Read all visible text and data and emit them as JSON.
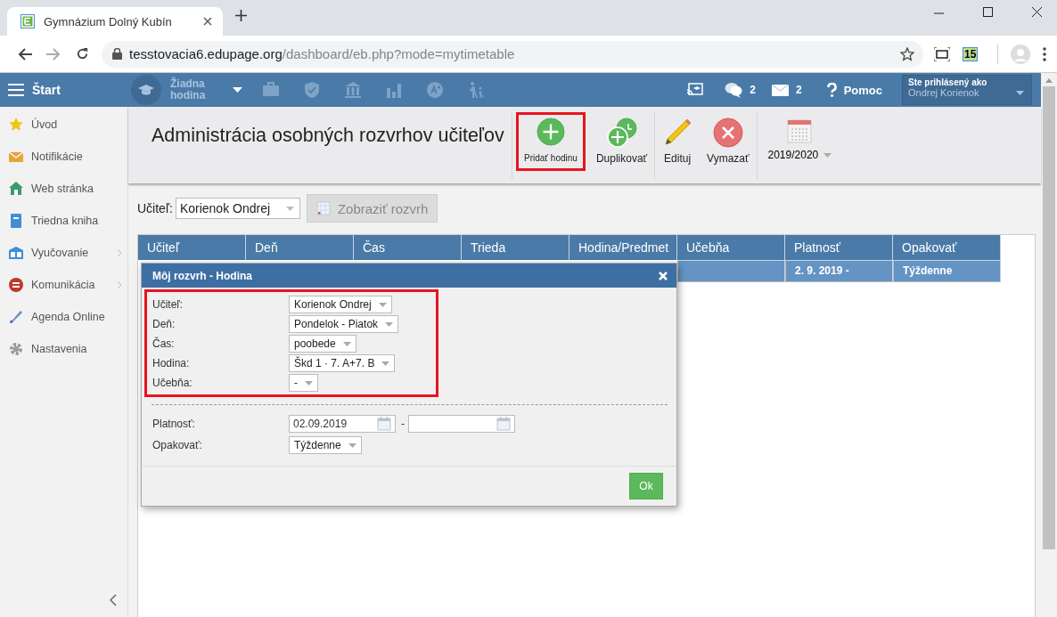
{
  "browser": {
    "tab_title": "Gymnázium Dolný Kubín",
    "url_host": "tesstovacia6.edupage.org",
    "url_path": "/dashboard/eb.php?mode=mytimetable",
    "extension_badge": "15"
  },
  "header": {
    "menu_label": "Štart",
    "lesson_selector": "Žiadna hodina",
    "chat_count": "2",
    "mail_count": "2",
    "help_label": "Pomoc",
    "user_caption": "Ste prihlásený ako",
    "user_name": "Ondrej Korienok"
  },
  "sidebar": {
    "items": [
      {
        "label": "Úvod",
        "has_submenu": false
      },
      {
        "label": "Notifikácie",
        "has_submenu": false
      },
      {
        "label": "Web stránka",
        "has_submenu": false
      },
      {
        "label": "Triedna kniha",
        "has_submenu": false
      },
      {
        "label": "Vyučovanie",
        "has_submenu": true
      },
      {
        "label": "Komunikácia",
        "has_submenu": true
      },
      {
        "label": "Agenda Online",
        "has_submenu": false
      },
      {
        "label": "Nastavenia",
        "has_submenu": false
      }
    ]
  },
  "page_title": "Administrácia osobných rozvrhov učiteľov",
  "toolbar": {
    "buttons": [
      {
        "label": "Pridať hodinu",
        "highlighted": true
      },
      {
        "label": "Duplikovať",
        "highlighted": false
      },
      {
        "label": "Edituj",
        "highlighted": false
      },
      {
        "label": "Vymazať",
        "highlighted": false
      }
    ],
    "year_selector": "2019/2020"
  },
  "filter": {
    "label": "Učiteľ:",
    "teacher": "Korienok Ondrej",
    "show_button": {
      "label": "Zobraziť rozvrh",
      "disabled": true
    }
  },
  "table": {
    "columns": [
      "Učiteľ",
      "Deň",
      "Čas",
      "Trieda",
      "Hodina/Predmet",
      "Učebňa",
      "Platnosť",
      "Opakovať"
    ],
    "rows": [
      {
        "selected": true,
        "validity": "2. 9. 2019 -",
        "repeat": "Týždenne"
      }
    ]
  },
  "dialog": {
    "title": "Môj rozvrh - Hodina",
    "highlighted_fields": [
      {
        "label": "Učiteľ:",
        "value": "Korienok Ondrej"
      },
      {
        "label": "Deň:",
        "value": "Pondelok - Piatok"
      },
      {
        "label": "Čas:",
        "value": "poobede"
      },
      {
        "label": "Hodina:",
        "value": "Škd 1 · 7. A+7. B"
      },
      {
        "label": "Učebňa:",
        "value": "-"
      }
    ],
    "validity": {
      "label": "Platnosť:",
      "from": "02.09.2019",
      "separator": "-"
    },
    "repeat": {
      "label": "Opakovať:",
      "value": "Týždenne"
    },
    "ok_button": "Ok"
  }
}
